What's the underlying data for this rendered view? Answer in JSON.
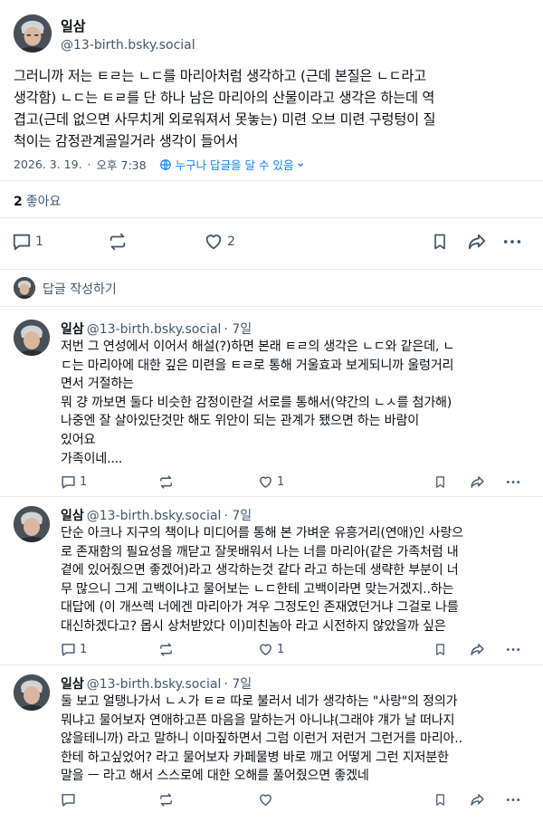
{
  "post": {
    "author_name": "일삼",
    "author_handle": "@13-birth.bsky.social",
    "text_lines": [
      "그러니까 저는 ㅌㄹ는 ㄴㄷ를 마리아처럼 생각하고 (근데 본질은 ㄴㄷ라고",
      "생각함) ㄴㄷ는 ㅌㄹ를 단 하나 남은 마리아의 산물이라고 생각은 하는데 역",
      "겹고(근데 없으면 사무치게 외로워져서 못놓는) 미련 오브 미련 구렁텅이 질",
      "척이는 감정관계골일거라 생각이 들어서"
    ],
    "date": "2026. 3. 19.",
    "separator": "·",
    "time": "오후 7:38",
    "reply_setting": "누구나 답글을 달 수 있음",
    "like_count": "2",
    "like_label": "좋아요",
    "reply_count": "1",
    "likes_action_count": "2"
  },
  "compose": {
    "placeholder": "답글 작성하기"
  },
  "replies": [
    {
      "author_name": "일삼",
      "author_handle": "@13-birth.bsky.social",
      "age": "· 7일",
      "text_lines": [
        "저번 그 연성에서 이어서 해설(?)하면 본래 ㅌㄹ의 생각은 ㄴㄷ와 같은데, ㄴ",
        "ㄷ는 마리아에 대한 깊은 미련을 ㅌㄹ로 통해 거울효과 보게되니까 울렁거리",
        "면서 거절하는",
        "뭐 걍 까보면 둘다 비슷한 감정이란걸 서로를 통해서(약간의 ㄴㅅ를 첨가해)",
        "나중엔 잘 살아있단것만 해도 위안이 되는 관계가 됐으면 하는 바람이",
        "있어요",
        "가족이네...."
      ],
      "reply_count": "1",
      "like_count": "1"
    },
    {
      "author_name": "일삼",
      "author_handle": "@13-birth.bsky.social",
      "age": "· 7일",
      "text_lines": [
        "단순 아크나 지구의 책이나 미디어를 통해 본 가벼운 유흥거리(연애)인 사랑으",
        "로 존재함의 필요성을 깨닫고 잘못배워서 나는 너를 마리아(같은 가족처럼 내",
        "곁에 있어줬으면 좋겠어)라고 생각하는것 같다 라고 하는데 생략한 부분이 너",
        "무 많으니 그게 고백이냐고 물어보는 ㄴㄷ한테 고백이라면 맞는거겠지..하는",
        "대답에 (이 개쓰렉 너에겐 마리아가 겨우 그정도인 존재였던거냐 그걸로 나를",
        "대신하겠다고? 몹시 상처받았다 이)미친놈아 라고 시전하지 않았을까 싶은"
      ],
      "reply_count": "1",
      "like_count": "1"
    },
    {
      "author_name": "일삼",
      "author_handle": "@13-birth.bsky.social",
      "age": "· 7일",
      "text_lines": [
        "둘 보고 얼탱나가서 ㄴㅅ가 ㅌㄹ 따로 불러서 네가 생각하는 \"사랑\"의 정의가",
        "뭐냐고 물어보자 연애하고픈 마음을 말하는거 아니냐(그래야 걔가 날 떠나지",
        "않을테니까) 라고 말하니 이마짚하면서 그럼 이런거 저런거 그런거를 마리아..",
        "한테 하고싶었어? 라고 물어보자 카페물병 바로 깨고 어떻게 그런 지저분한",
        "말을 ㅡ 라고 해서 스스로에 대한 오해를 풀어줬으면 좋겠네"
      ],
      "reply_count": "",
      "like_count": ""
    }
  ],
  "colors": {
    "accent": "#1083fe",
    "muted": "#42576c",
    "text": "#0b0f14",
    "divider": "#e6e9ed"
  },
  "icons": [
    "reply-icon",
    "repost-icon",
    "heart-icon",
    "bookmark-icon",
    "share-icon",
    "more-icon",
    "globe-icon",
    "chevron-down-icon"
  ]
}
